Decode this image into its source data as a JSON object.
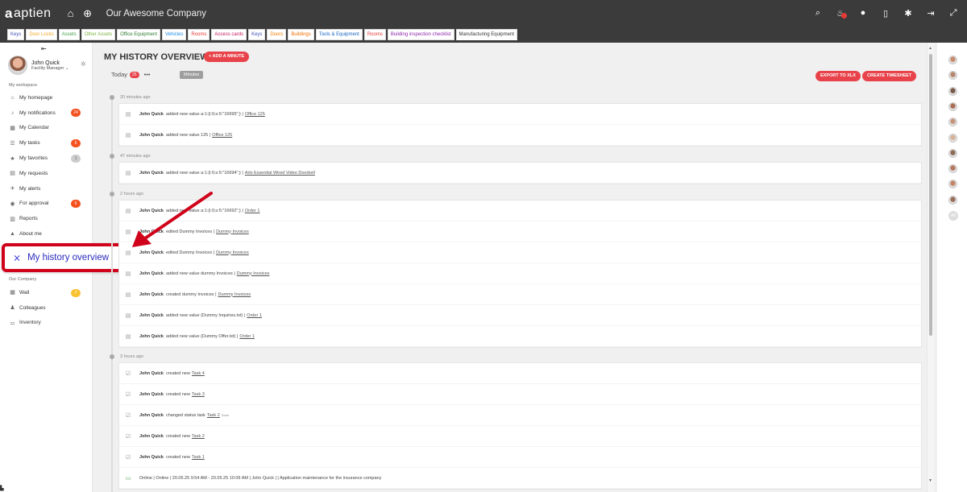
{
  "brand": {
    "name": "aptien",
    "mark": "a",
    "company": "Our Awesome Company"
  },
  "icons": {
    "home": "home-icon",
    "add": "plus-circle-icon",
    "search": "search-icon",
    "alerts": "bell-icon",
    "chat": "chat-icon",
    "mobile": "mobile-icon",
    "settings": "gear-icon",
    "logout": "logout-icon",
    "expand": "expand-icon"
  },
  "tabs": [
    {
      "label": "Keys",
      "color": "#3f51b5"
    },
    {
      "label": "Door Locks",
      "color": "#f5a623"
    },
    {
      "label": "Assets",
      "color": "#43a047"
    },
    {
      "label": "Other Assets",
      "color": "#7cb342"
    },
    {
      "label": "Office Equipment",
      "color": "#2e7d32"
    },
    {
      "label": "Vehicles",
      "color": "#1e88e5"
    },
    {
      "label": "Rooms",
      "color": "#e53935"
    },
    {
      "label": "Access cards",
      "color": "#c2185b"
    },
    {
      "label": "Keys",
      "color": "#3f51b5"
    },
    {
      "label": "Doors",
      "color": "#f57c00"
    },
    {
      "label": "Buildings",
      "color": "#ef6c00"
    },
    {
      "label": "Tools & Equipment",
      "color": "#1565c0"
    },
    {
      "label": "Rooms",
      "color": "#e53935"
    },
    {
      "label": "Building inspection checklist",
      "color": "#8e24aa"
    },
    {
      "label": "Manufacturing Equipment",
      "color": "#333333"
    }
  ],
  "profile": {
    "name": "John Quick",
    "role": "Facility Manager"
  },
  "sidebar": {
    "workspace_title": "My workspace",
    "items": [
      {
        "label": "My homepage",
        "icon": "home-icon",
        "glyph": "⌂"
      },
      {
        "label": "My notifications",
        "icon": "bell-icon",
        "glyph": "♪",
        "count": "24",
        "countColor": "red"
      },
      {
        "label": "My Calendar",
        "icon": "calendar-icon",
        "glyph": "▦"
      },
      {
        "label": "My tasks",
        "icon": "tasks-icon",
        "glyph": "☰",
        "count": "5",
        "countColor": "red"
      },
      {
        "label": "My favorites",
        "icon": "star-icon",
        "glyph": "★",
        "count": "1",
        "countColor": "gray"
      },
      {
        "label": "My requests",
        "icon": "requests-icon",
        "glyph": "▤"
      },
      {
        "label": "My alerts",
        "icon": "megaphone-icon",
        "glyph": "✈"
      },
      {
        "label": "For approval",
        "icon": "approval-icon",
        "glyph": "◉",
        "count": "6",
        "countColor": "red"
      },
      {
        "label": "Reports",
        "icon": "reports-icon",
        "glyph": "▥"
      },
      {
        "label": "About me",
        "icon": "user-icon",
        "glyph": "▲"
      }
    ],
    "highlight_label": "My history overview",
    "company_title": "Our Company",
    "company_items": [
      {
        "label": "Wall",
        "icon": "wall-icon",
        "glyph": "▦",
        "count": "7",
        "countColor": "yellow"
      },
      {
        "label": "Colleagues",
        "icon": "colleagues-icon",
        "glyph": "♟"
      },
      {
        "label": "Inventory",
        "icon": "inventory-icon",
        "glyph": "⚍"
      }
    ]
  },
  "main": {
    "title": "MY HISTORY OVERVIEW",
    "add_minute": "+ ADD A MINUTE",
    "today_label": "Today",
    "today_count": "25",
    "minutes_label": "Minutes",
    "export_label": "EXPORT TO XLX",
    "timesheet_label": "CREATE TIMESHEET"
  },
  "history": [
    {
      "time": "20 minutes ago",
      "rows": [
        {
          "icon": "document-icon",
          "glyph": "▤",
          "user": "John Quick",
          "text": "added new value  a:1:{i:0;s:5:\"16695\";} |",
          "link": "Office 125"
        },
        {
          "icon": "document-icon",
          "glyph": "▤",
          "user": "John Quick",
          "text": "added new value  125 |",
          "link": "Office 125"
        }
      ]
    },
    {
      "time": "47 minutes ago",
      "rows": [
        {
          "icon": "document-icon",
          "glyph": "▤",
          "user": "John Quick",
          "text": "added new value  a:1:{i:0;s:5:\"16694\";} |",
          "link": "Arlo Essential Wired Video Doorbell"
        }
      ]
    },
    {
      "time": "2 hours ago",
      "rows": [
        {
          "icon": "document-icon",
          "glyph": "▤",
          "user": "John Quick",
          "text": "added new value  a:1:{i:0;s:5:\"16692\";} |",
          "link": "Order 1"
        },
        {
          "icon": "document-icon",
          "glyph": "▤",
          "user": "John Quick",
          "text": "edited  Dummy Invoices |",
          "link": "Dummy Invoices"
        },
        {
          "icon": "document-icon",
          "glyph": "▤",
          "user": "John Quick",
          "text": "edited  Dummy Invoices |",
          "link": "Dummy Invoices"
        },
        {
          "icon": "document-icon",
          "glyph": "▤",
          "user": "John Quick",
          "text": "added new value  dummy Invoices |",
          "link": "Dummy Invoices"
        },
        {
          "icon": "document-icon",
          "glyph": "▤",
          "user": "John Quick",
          "text": "created  dummy Invoices |",
          "link": "Dummy Invoices"
        },
        {
          "icon": "document-icon",
          "glyph": "▤",
          "user": "John Quick",
          "text": "added new value   (Dummy Inquiries.txt) |",
          "link": "Order 1"
        },
        {
          "icon": "document-icon",
          "glyph": "▤",
          "user": "John Quick",
          "text": "added new value   (Dummy Offer.txt) |",
          "link": "Order 1"
        }
      ]
    },
    {
      "time": "3 hours ago",
      "rows": [
        {
          "icon": "task-check-icon",
          "glyph": "☑",
          "user": "John Quick",
          "text": "created new ",
          "link": "Task 4"
        },
        {
          "icon": "task-check-icon",
          "glyph": "☑",
          "user": "John Quick",
          "text": "created new ",
          "link": "Task 3"
        },
        {
          "icon": "task-check-icon",
          "glyph": "☑",
          "user": "John Quick",
          "text": "changed status task",
          "link": "Task 2",
          "suffix": "Done"
        },
        {
          "icon": "task-check-icon",
          "glyph": "☑",
          "user": "John Quick",
          "text": "created new ",
          "link": "Task 2"
        },
        {
          "icon": "task-check-icon",
          "glyph": "☑",
          "user": "John Quick",
          "text": "created new ",
          "link": "Task 1"
        },
        {
          "icon": "monitor-icon",
          "glyph": "▭",
          "user": "",
          "text": "Online | Online | 20.05.25 9:54 AM - 20.05.25 10:09 AM | John Quick |  | Application maintenance for the insurance company",
          "link": ""
        }
      ]
    }
  ],
  "colleagues_add": "Ad"
}
